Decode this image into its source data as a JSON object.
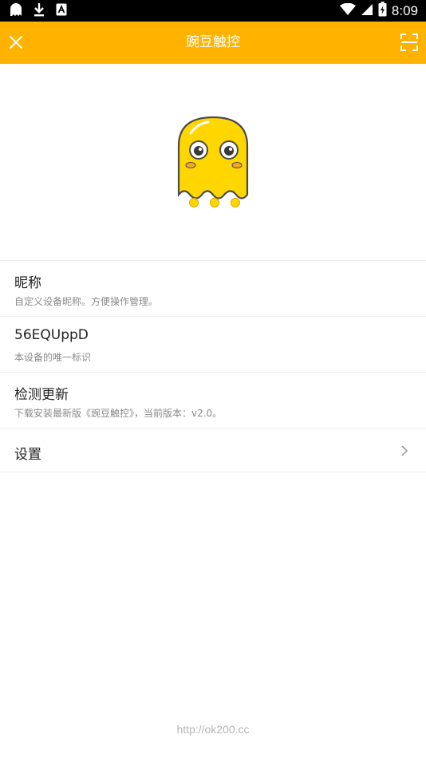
{
  "status_bar": {
    "time": "8:09",
    "icons": [
      "ghost-icon",
      "download-icon",
      "a-icon",
      "wifi-icon",
      "signal-icon",
      "battery-icon"
    ]
  },
  "app_bar": {
    "title": "豌豆触控",
    "left_icon": "close-icon",
    "right_icon": "scan-icon",
    "background_color": "#FFB300"
  },
  "hero": {
    "icon": "ghost-mascot-icon"
  },
  "list": {
    "nickname": {
      "title": "昵称",
      "subtitle": "自定义设备昵称。方便操作管理。"
    },
    "device_id": {
      "title": "56EQUppD",
      "subtitle": "本设备的唯一标识"
    },
    "update": {
      "title": "检测更新",
      "subtitle": "下载安装最新版《豌豆触控》，当前版本：v2.0。"
    },
    "settings": {
      "title": "设置",
      "icon": "chevron-right-icon"
    }
  },
  "footer": {
    "text": "http://ok200.cc"
  }
}
